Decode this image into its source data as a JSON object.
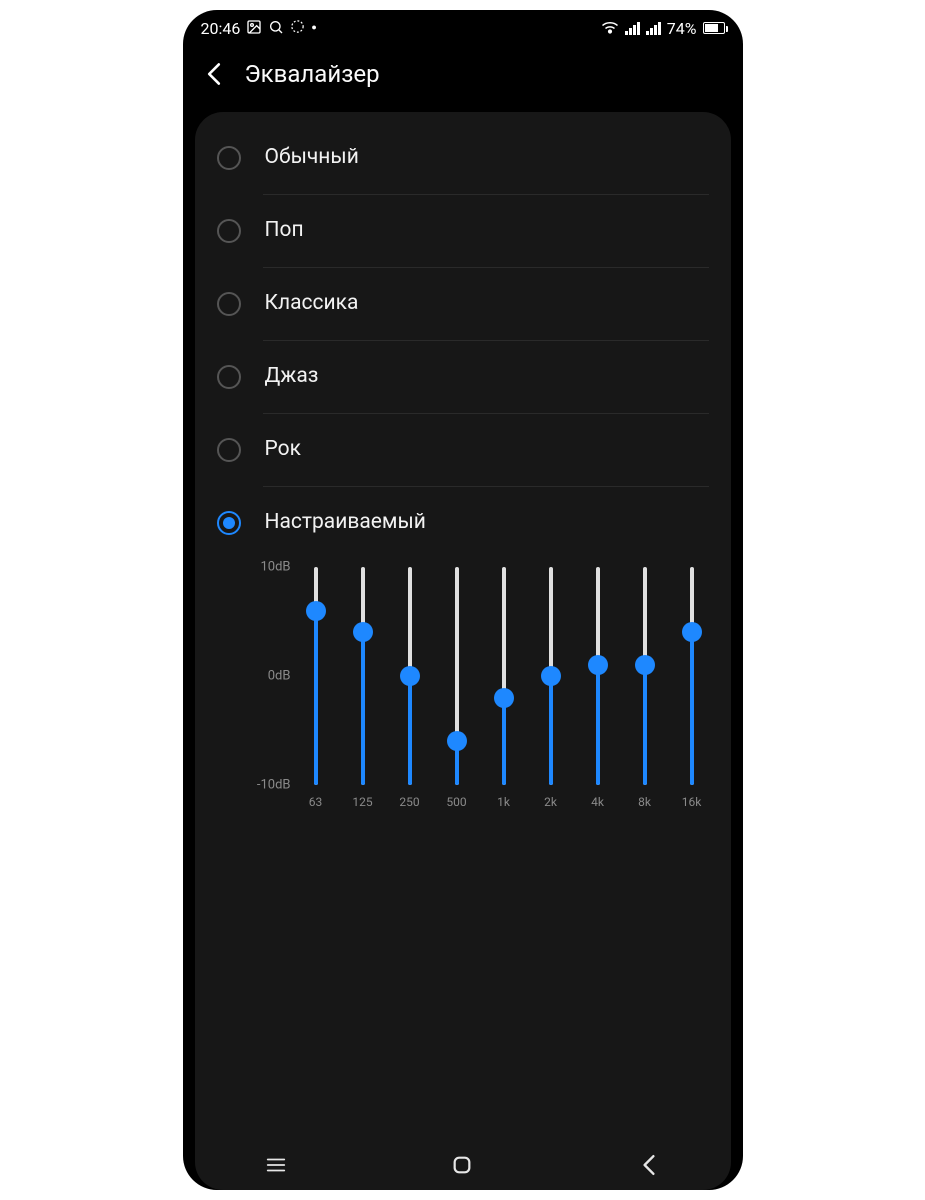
{
  "status": {
    "time": "20:46",
    "icons_left": [
      "image-icon",
      "search-icon",
      "loading-icon",
      "dot-icon"
    ],
    "icons_right": [
      "wifi-icon",
      "signal1-icon",
      "signal2-icon"
    ],
    "battery_percent": "74%",
    "battery_level": 74
  },
  "header": {
    "title": "Эквалайзер"
  },
  "presets": {
    "selected_index": 5,
    "items": [
      {
        "label": "Обычный"
      },
      {
        "label": "Поп"
      },
      {
        "label": "Классика"
      },
      {
        "label": "Джаз"
      },
      {
        "label": "Рок"
      },
      {
        "label": "Настраиваемый"
      }
    ]
  },
  "chart_data": {
    "type": "bar",
    "title": "",
    "xlabel": "",
    "ylabel": "dB",
    "ylim": [
      -10,
      10
    ],
    "y_ticks": [
      "10dB",
      "0dB",
      "-10dB"
    ],
    "categories": [
      "63",
      "125",
      "250",
      "500",
      "1k",
      "2k",
      "4k",
      "8k",
      "16k"
    ],
    "values": [
      6,
      4,
      0,
      -6,
      -2,
      0,
      1,
      1,
      4
    ]
  },
  "colors": {
    "accent": "#1E88FF",
    "card": "#171717",
    "bg": "#000000",
    "muted": "#8a8a8a"
  }
}
